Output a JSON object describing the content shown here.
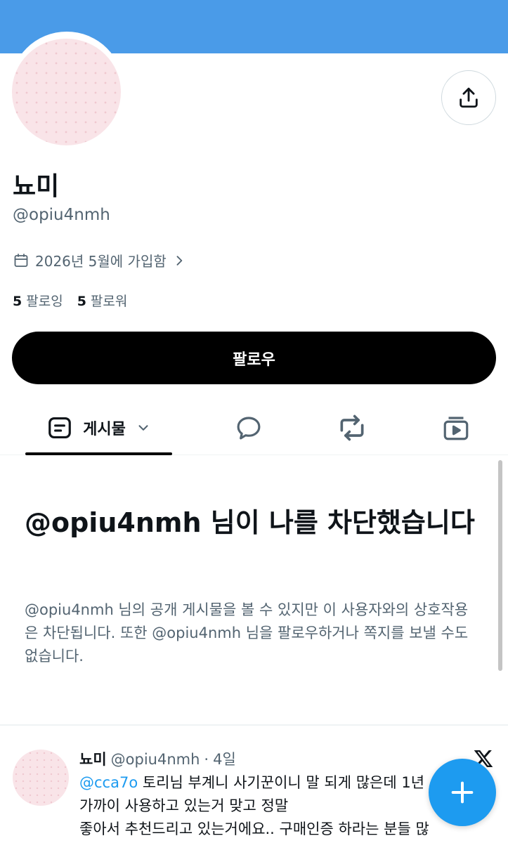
{
  "profile": {
    "name": "뇨미",
    "handle": "@opiu4nmh",
    "joined": "2026년 5월에 가입함",
    "following_count": "5",
    "following_label": "팔로잉",
    "followers_count": "5",
    "followers_label": "팔로워",
    "follow_label": "팔로우"
  },
  "tabs": {
    "posts_label": "게시물"
  },
  "blocked": {
    "title": "@opiu4nmh 님이 나를 차단했습니다",
    "body": "@opiu4nmh 님의 공개 게시물을 볼 수 있지만 이 사용자와의 상호작용은 차단됩니다. 또한 @opiu4nmh 님을 팔로우하거나 쪽지를 보낼 수도 없습니다."
  },
  "post": {
    "name": "뇨미",
    "handle": "@opiu4nmh",
    "separator": "·",
    "time": "4일",
    "mention": "@cca7o",
    "text_line1": " 토리님 부계니 사기꾼이니 말 되게 많은데 1년",
    "text_line2": "가까이 사용하고 있는거 맞고 정말",
    "text_line3": "좋아서 추천드리고 있는거에요.. 구매인증 하라는 분들 많"
  },
  "colors": {
    "banner": "#4a9be8",
    "accent": "#1d9bf0",
    "text": "#0f1419",
    "muted": "#536471"
  },
  "icons": [
    "share-icon",
    "calendar-icon",
    "chevron-right-icon",
    "posts-icon",
    "chevron-down-icon",
    "reply-icon",
    "repost-icon",
    "media-icon",
    "x-logo-icon",
    "plus-icon"
  ]
}
